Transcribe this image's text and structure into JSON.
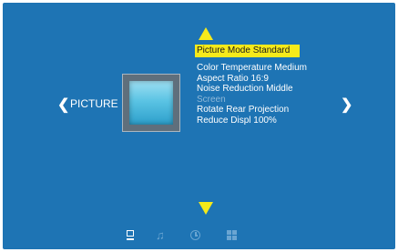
{
  "colors": {
    "background": "#1e74b4",
    "highlight": "#f6ea1a",
    "text": "#ffffff",
    "disabled_text": "#8fb8d8",
    "inactive_icon": "#6aa5d2"
  },
  "nav": {
    "left_glyph": "❮",
    "right_glyph": "❯",
    "section_label": "PICTURE"
  },
  "menu": {
    "items": [
      {
        "label": "Picture Mode Standard",
        "state": "selected"
      },
      {
        "label": "Color  Temperature Medium",
        "state": "normal"
      },
      {
        "label": "Aspect  Ratio 16:9",
        "state": "normal"
      },
      {
        "label": "Noise Reduction Middle",
        "state": "normal"
      },
      {
        "label": "Screen",
        "state": "disabled"
      },
      {
        "label": "Rotate Rear Projection",
        "state": "normal"
      },
      {
        "label": "Reduce Displ 100%",
        "state": "normal"
      }
    ]
  },
  "bottom_bar": {
    "icons": [
      "tv-icon",
      "music-icon",
      "clock-icon",
      "grid-icon"
    ],
    "active": "tv-icon",
    "music_glyph": "♫"
  }
}
